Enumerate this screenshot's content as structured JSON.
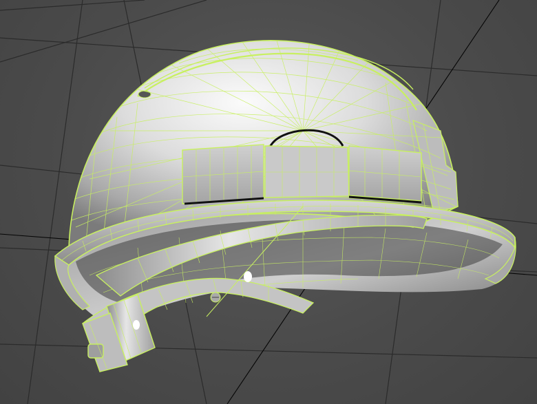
{
  "viewport": {
    "view_mode": "perspective",
    "display_mode": "shaded-with-wireframe"
  },
  "scene": {
    "object": "hard-hat",
    "object_icon": "helmet-mesh-icon",
    "colors": {
      "background": "#4a4a4a",
      "grid_line": "#2a2a2a",
      "world_axis": "#000000",
      "wireframe": "#c8f060",
      "shell_light": "#f2f2f2",
      "shell_mid": "#c6c6c6",
      "shell_dark": "#7a7a7a",
      "inner_shadow": "#3c3c3c"
    }
  }
}
